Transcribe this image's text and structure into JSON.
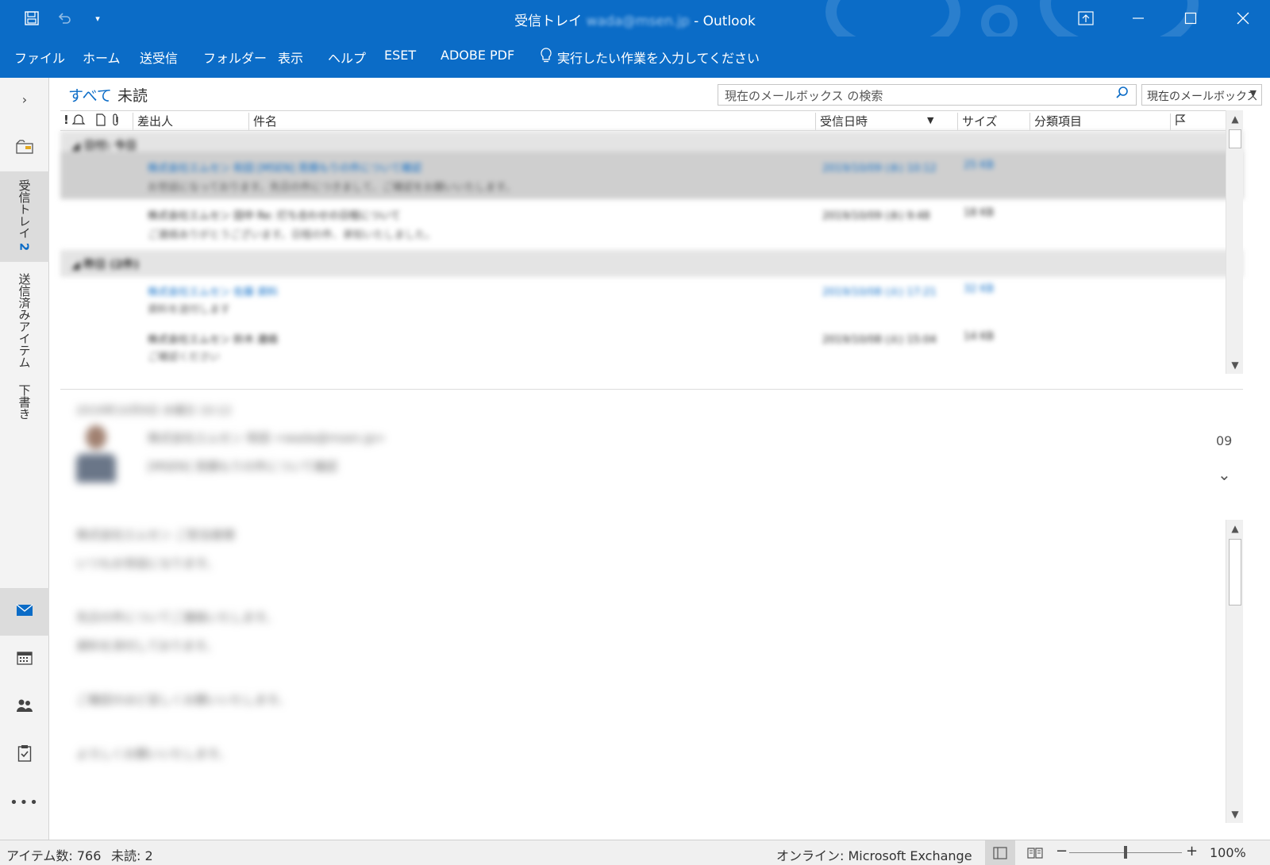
{
  "window": {
    "title_folder": "受信トレイ",
    "title_account": "wada@msen.jp",
    "title_sep": "-",
    "title_app": "Outlook"
  },
  "quick_access": {
    "save_icon": "save-icon",
    "undo_icon": "undo-icon",
    "customize_icon": "dropdown-icon"
  },
  "ribbon": {
    "tabs": [
      "ファイル",
      "ホーム",
      "送受信",
      "フォルダー",
      "表示",
      "ヘルプ",
      "ESET",
      "ADOBE PDF"
    ],
    "tell_me": "実行したい作業を入力してください"
  },
  "folders": [
    {
      "label": "受信トレイ",
      "count": "2"
    },
    {
      "label": "送信済みアイテム"
    },
    {
      "label": "下書き"
    }
  ],
  "filters": {
    "all": "すべて",
    "unread": "未読"
  },
  "search": {
    "placeholder": "現在のメールボックス の検索",
    "scope": "現在のメールボックス"
  },
  "columns": {
    "importance": "!",
    "sender": "差出人",
    "subject": "件名",
    "received": "受信日時",
    "size": "サイズ",
    "category": "分類項目"
  },
  "groups": [
    {
      "label": "◢ 日付: 今日"
    },
    {
      "label": "◢ 昨日 (2件)"
    }
  ],
  "messages": [
    {
      "sender": "株式会社エムセン 和田",
      "subject": "[MSEN] 見積もりの件について確認",
      "preview": "お世話になっております。先日の件につきまして、ご確認をお願いいたします。",
      "received": "2019/10/09 (水) 10:12",
      "size": "25 KB"
    },
    {
      "sender": "株式会社エムセン 田中",
      "subject": "Re: 打ち合わせの日程について",
      "preview": "ご連絡ありがとうございます。日程の件、承知いたしました。",
      "received": "2019/10/09 (水) 9:48",
      "size": "18 KB"
    },
    {
      "sender": "株式会社エムセン 佐藤",
      "subject": "資料",
      "preview": "資料を送付します",
      "received": "2019/10/08 (火) 17:21",
      "size": "32 KB"
    },
    {
      "sender": "株式会社エムセン 鈴木",
      "subject": "連絡",
      "preview": "ご確認ください",
      "received": "2019/10/08 (火) 15:04",
      "size": "14 KB"
    }
  ],
  "reading": {
    "header": "2019年10月9日 水曜日 10:12",
    "from_line": "株式会社エムセン 和田 <wada@msen.jp>",
    "subject_line": "[MSEN] 見積もりの件について確認",
    "side_text": "09",
    "body": [
      "株式会社エムセン ご担当者様",
      "いつもお世話になります。",
      "先日の件についてご連絡いたします。",
      "資料を添付しております。",
      "ご確認のほど宜しくお願いいたします。",
      "よろしくお願いいたします。"
    ]
  },
  "status": {
    "items": "アイテム数: 766",
    "unread": "未読: 2",
    "connection": "オンライン: Microsoft Exchange",
    "zoom": "100%"
  },
  "colors": {
    "accent": "#0b6cc7",
    "pane": "#f3f3f3"
  }
}
